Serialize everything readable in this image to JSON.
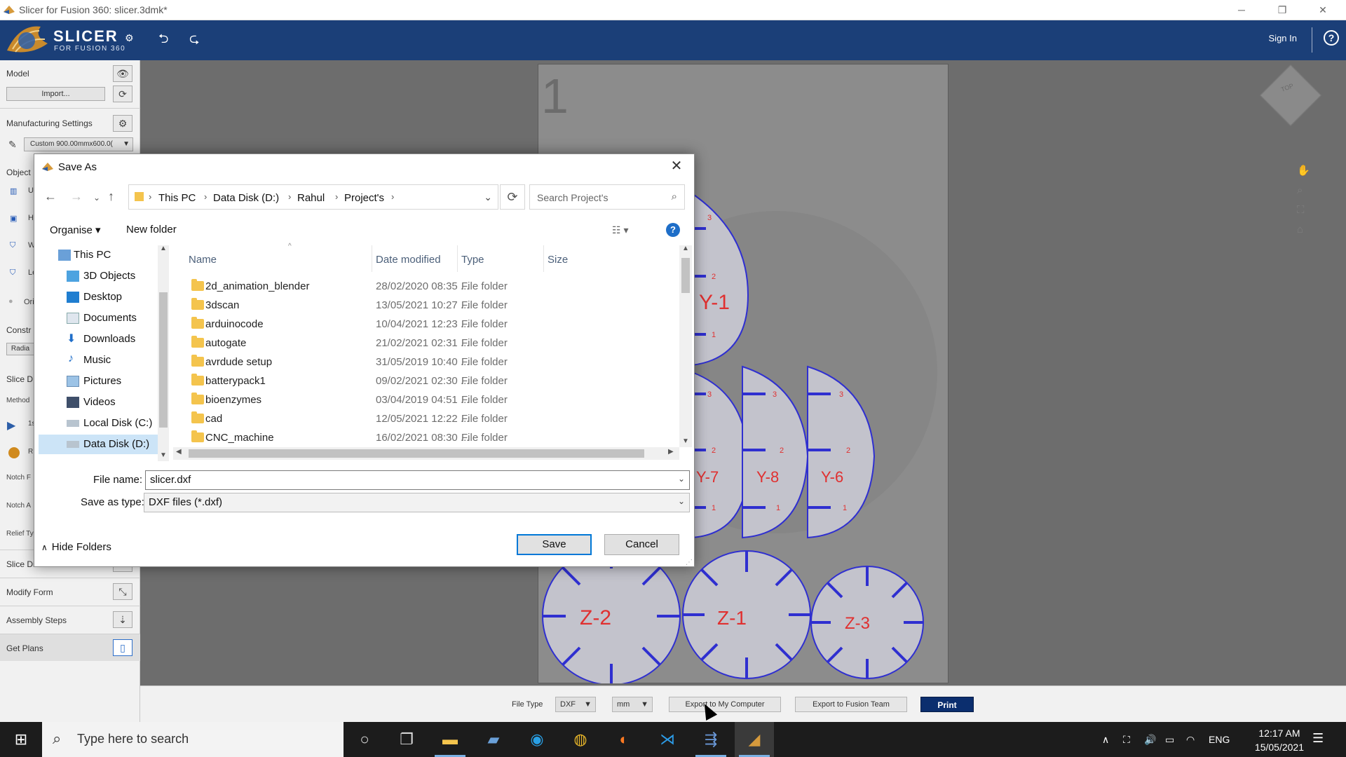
{
  "window": {
    "title": "Slicer for Fusion 360: slicer.3dmk*",
    "controls": [
      "─",
      "❐",
      "✕"
    ]
  },
  "header": {
    "logo": "SLICER",
    "logo_sub": "FOR FUSION 360",
    "sign_in": "Sign In",
    "help": "?"
  },
  "left_panel": {
    "model": "Model",
    "import": "Import...",
    "manufacturing": "Manufacturing Settings",
    "material": "Custom 900.00mmx600.0(",
    "object": "Object",
    "row_labels": [
      "U",
      "H",
      "W",
      "Le"
    ],
    "orient": "Ori",
    "construct": "Constr",
    "radial": "Radia",
    "slice_d": "Slice D",
    "method": "Method",
    "method_val": "1s",
    "r_label": "R",
    "notch_f": "Notch F",
    "notch_a": "Notch A",
    "relief": "Relief Ty",
    "slice_direction": "Slice Direction",
    "modify_form": "Modify Form",
    "assembly_steps": "Assembly Steps",
    "get_plans": "Get Plans"
  },
  "canvas": {
    "sheet_number": "1",
    "labels": [
      "Y-8",
      "Y-6",
      "Y-7",
      "Y-1",
      "Z-2",
      "Z-1",
      "Z-3"
    ],
    "notch_numbers": [
      "1",
      "2",
      "3"
    ],
    "cube_label": "TOP"
  },
  "bottom_bar": {
    "file_type_label": "File Type",
    "file_type": "DXF",
    "unit": "mm",
    "export_computer": "Export to My Computer",
    "export_fusion": "Export to Fusion Team",
    "print": "Print"
  },
  "dialog": {
    "title": "Save As",
    "breadcrumbs": [
      "This PC",
      "Data Disk (D:)",
      "Rahul",
      "Project's"
    ],
    "search_placeholder": "Search Project's",
    "organise": "Organise ▾",
    "new_folder": "New folder",
    "tree": [
      {
        "label": "This PC",
        "icon": "pc-icon",
        "selected": false
      },
      {
        "label": "3D Objects",
        "icon": "cube-folder-icon",
        "selected": false
      },
      {
        "label": "Desktop",
        "icon": "desktop-icon",
        "selected": false
      },
      {
        "label": "Documents",
        "icon": "documents-icon",
        "selected": false
      },
      {
        "label": "Downloads",
        "icon": "downloads-icon",
        "selected": false
      },
      {
        "label": "Music",
        "icon": "music-icon",
        "selected": false
      },
      {
        "label": "Pictures",
        "icon": "pictures-icon",
        "selected": false
      },
      {
        "label": "Videos",
        "icon": "videos-icon",
        "selected": false
      },
      {
        "label": "Local Disk (C:)",
        "icon": "disk-icon",
        "selected": false
      },
      {
        "label": "Data Disk (D:)",
        "icon": "disk-icon",
        "selected": true
      }
    ],
    "columns": {
      "name": "Name",
      "date": "Date modified",
      "type": "Type",
      "size": "Size"
    },
    "files": [
      {
        "name": "2d_animation_blender",
        "date": "28/02/2020 08:35 ...",
        "type": "File folder"
      },
      {
        "name": "3dscan",
        "date": "13/05/2021 10:27 ...",
        "type": "File folder"
      },
      {
        "name": "arduinocode",
        "date": "10/04/2021 12:23 ...",
        "type": "File folder"
      },
      {
        "name": "autogate",
        "date": "21/02/2021 02:31 ...",
        "type": "File folder"
      },
      {
        "name": "avrdude setup",
        "date": "31/05/2019 10:40 ...",
        "type": "File folder"
      },
      {
        "name": "batterypack1",
        "date": "09/02/2021 02:30 ...",
        "type": "File folder"
      },
      {
        "name": "bioenzymes",
        "date": "03/04/2019 04:51 ...",
        "type": "File folder"
      },
      {
        "name": "cad",
        "date": "12/05/2021 12:22 ...",
        "type": "File folder"
      },
      {
        "name": "CNC_machine",
        "date": "16/02/2021 08:30 ...",
        "type": "File folder"
      }
    ],
    "file_name_label": "File name:",
    "file_name": "slicer.dxf",
    "save_type_label": "Save as type:",
    "save_type": "DXF files (*.dxf)",
    "save": "Save",
    "cancel": "Cancel",
    "hide_folders": "Hide Folders"
  },
  "taskbar": {
    "search_placeholder": "Type here to search",
    "language": "ENG",
    "time": "12:17 AM",
    "date": "15/05/2021"
  },
  "colors": {
    "header": "#1b3f78",
    "part_fill": "#c3c3cc",
    "part_stroke": "#2f2fd0",
    "label": "#e03030",
    "print": "#0b2e6e",
    "accent": "#0078d7"
  }
}
